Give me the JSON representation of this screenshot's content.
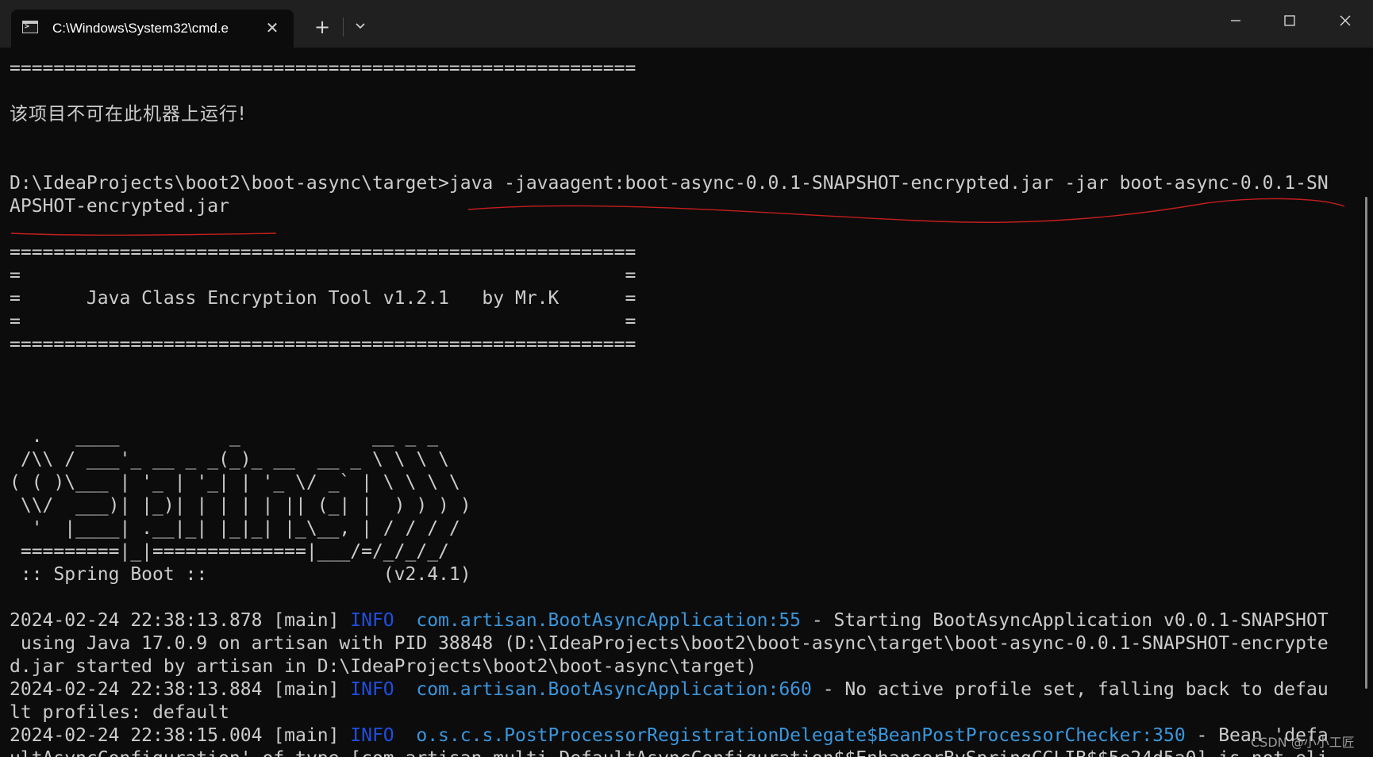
{
  "window": {
    "tab_title": "C:\\Windows\\System32\\cmd.e",
    "new_tab_label": "+",
    "tab_close_label": "✕"
  },
  "terminal": {
    "lines": [
      "=========================================================",
      "",
      "该项目不可在此机器上运行!",
      "",
      "",
      "D:\\IdeaProjects\\boot2\\boot-async\\target>java -javaagent:boot-async-0.0.1-SNAPSHOT-encrypted.jar -jar boot-async-0.0.1-SN",
      "APSHOT-encrypted.jar",
      "",
      "=========================================================",
      "=                                                       =",
      "=      Java Class Encryption Tool v1.2.1   by Mr.K      =",
      "=                                                       =",
      "=========================================================",
      "",
      "",
      "",
      "  .   ____          _            __ _ _",
      " /\\\\ / ___'_ __ _ _(_)_ __  __ _ \\ \\ \\ \\",
      "( ( )\\___ | '_ | '_| | '_ \\/ _` | \\ \\ \\ \\",
      " \\\\/  ___)| |_)| | | | | || (_| |  ) ) ) )",
      "  '  |____| .__|_| |_|_| |_\\__, | / / / /",
      " =========|_|==============|___/=/_/_/_/",
      " :: Spring Boot ::                (v2.4.1)",
      ""
    ],
    "logs": [
      {
        "prefix": "2024-02-24 22:38:13.878 [main] ",
        "level": "INFO",
        "class": "com.artisan.BootAsyncApplication:55",
        "msg": " - Starting BootAsyncApplication v0.0.1-SNAPSHOT",
        "cont": [
          " using Java 17.0.9 on artisan with PID 38848 (D:\\IdeaProjects\\boot2\\boot-async\\target\\boot-async-0.0.1-SNAPSHOT-encrypte",
          "d.jar started by artisan in D:\\IdeaProjects\\boot2\\boot-async\\target)"
        ]
      },
      {
        "prefix": "2024-02-24 22:38:13.884 [main] ",
        "level": "INFO",
        "class": "com.artisan.BootAsyncApplication:660",
        "msg": " - No active profile set, falling back to defau",
        "cont": [
          "lt profiles: default"
        ]
      },
      {
        "prefix": "2024-02-24 22:38:15.004 [main] ",
        "level": "INFO",
        "class": "o.s.c.s.PostProcessorRegistrationDelegate$BeanPostProcessorChecker:350",
        "msg": " - Bean 'defa",
        "cont": [
          "ultAsyncConfiguration' of type [com.artisan.multi.DefaultAsyncConfiguration$$EnhancerBySpringCGLIB$$5e24d5a0] is not eli"
        ]
      }
    ]
  },
  "watermark": "CSDN @小小工匠",
  "colors": {
    "background": "#0c0c0c",
    "text": "#cccccc",
    "info": "#1f4fe0",
    "class": "#3a96dd",
    "annotation": "#c41e1e"
  },
  "icons": [
    "cmd-icon",
    "close-icon",
    "plus-icon",
    "chevron-down-icon",
    "minimize-icon",
    "maximize-icon",
    "window-close-icon"
  ]
}
